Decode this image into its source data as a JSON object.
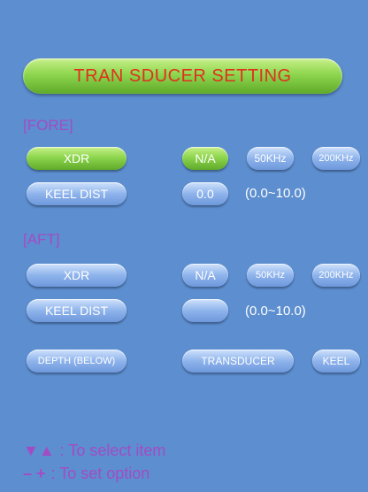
{
  "title": "TRAN SDUCER SETTING",
  "fore": {
    "label": "[FORE]",
    "xdr_label": "XDR",
    "xdr_options": [
      "N/A",
      "50KHz",
      "200KHz"
    ],
    "xdr_selected": "N/A",
    "keel_dist_label": "KEEL DIST",
    "keel_dist_value": "0.0",
    "keel_dist_range": "(0.0~10.0)"
  },
  "aft": {
    "label": "[AFT]",
    "xdr_label": "XDR",
    "xdr_options": [
      "N/A",
      "50KHz",
      "200KHz"
    ],
    "keel_dist_label": "KEEL DIST",
    "keel_dist_value": "",
    "keel_dist_range": "(0.0~10.0)"
  },
  "depth": {
    "label": "DEPTH (BELOW)",
    "options": [
      "TRANSDUCER",
      "KEEL"
    ]
  },
  "help": {
    "select_glyph": "▼▲",
    "select_text": ": To  select  item",
    "set_glyph": "– +",
    "set_text": ": To  set  option"
  },
  "colors": {
    "background": "#5c8ed0",
    "title_text": "#e0301e",
    "section_text": "#a24cc4",
    "selected": "#8ed64e",
    "button": "#8fb4ec"
  }
}
